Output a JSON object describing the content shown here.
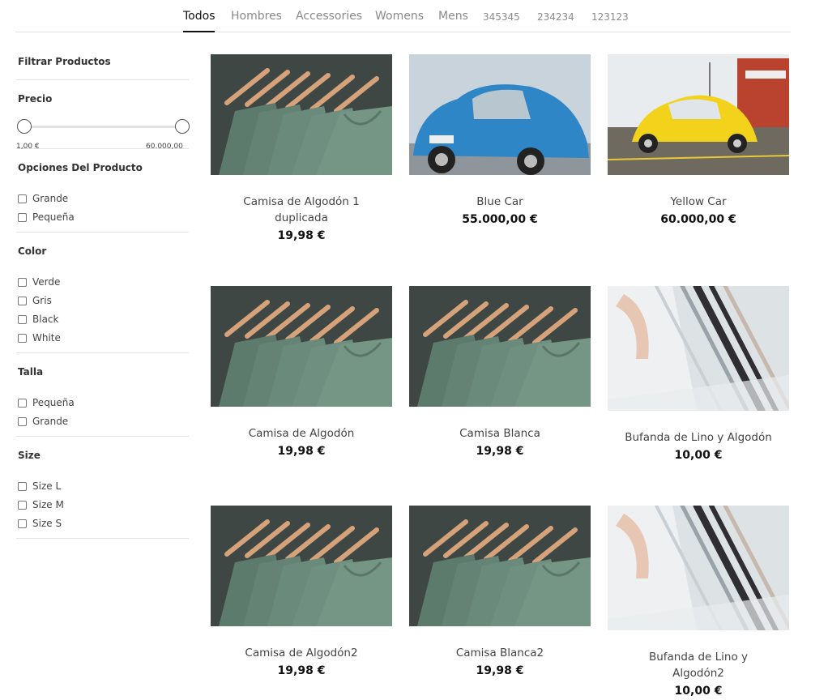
{
  "tabs": [
    "Todos",
    "Hombres",
    "Accessories",
    "Womens",
    "Mens",
    "345345",
    "234234",
    "123123"
  ],
  "filters": {
    "title": "Filtrar Productos",
    "price": {
      "label": "Precio",
      "min": "1,00 €",
      "max": "60.000,00"
    },
    "product_options": {
      "label": "Opciones Del Producto",
      "options": [
        "Grande",
        "Pequeña"
      ]
    },
    "color": {
      "label": "Color",
      "options": [
        "Verde",
        "Gris",
        "Black",
        "White"
      ]
    },
    "talla": {
      "label": "Talla",
      "options": [
        "Pequeña",
        "Grande"
      ]
    },
    "size": {
      "label": "Size",
      "options": [
        "Size L",
        "Size M",
        "Size S"
      ]
    }
  },
  "products": [
    {
      "name": "Camisa de Algodón 1 duplicada",
      "price": "19,98 €",
      "image": "green-shirts-image"
    },
    {
      "name": "Blue Car",
      "price": "55.000,00 €",
      "image": "blue-car-image"
    },
    {
      "name": "Yellow Car",
      "price": "60.000,00 €",
      "image": "yellow-car-image"
    },
    {
      "name": "Camisa de Algodón",
      "price": "19,98 €",
      "image": "green-shirts-image"
    },
    {
      "name": "Camisa Blanca",
      "price": "19,98 €",
      "image": "green-shirts-image"
    },
    {
      "name": "Bufanda de Lino y Algodón",
      "price": "10,00 €",
      "image": "scarf-image"
    },
    {
      "name": "Camisa de Algodón2",
      "price": "19,98 €",
      "image": "green-shirts-image"
    },
    {
      "name": "Camisa Blanca2",
      "price": "19,98 €",
      "image": "green-shirts-image"
    },
    {
      "name": "Bufanda de Lino y Algodón2",
      "price": "10,00 €",
      "image": "scarf-image"
    }
  ],
  "colors": {
    "shirt_bg": "#3f4744",
    "shirt": "#6f8f80",
    "hanger": "#d6a27a",
    "blue_car": "#2f86c6",
    "yellow_car": "#f2d21b",
    "scarf_bg": "#dde2e4"
  }
}
